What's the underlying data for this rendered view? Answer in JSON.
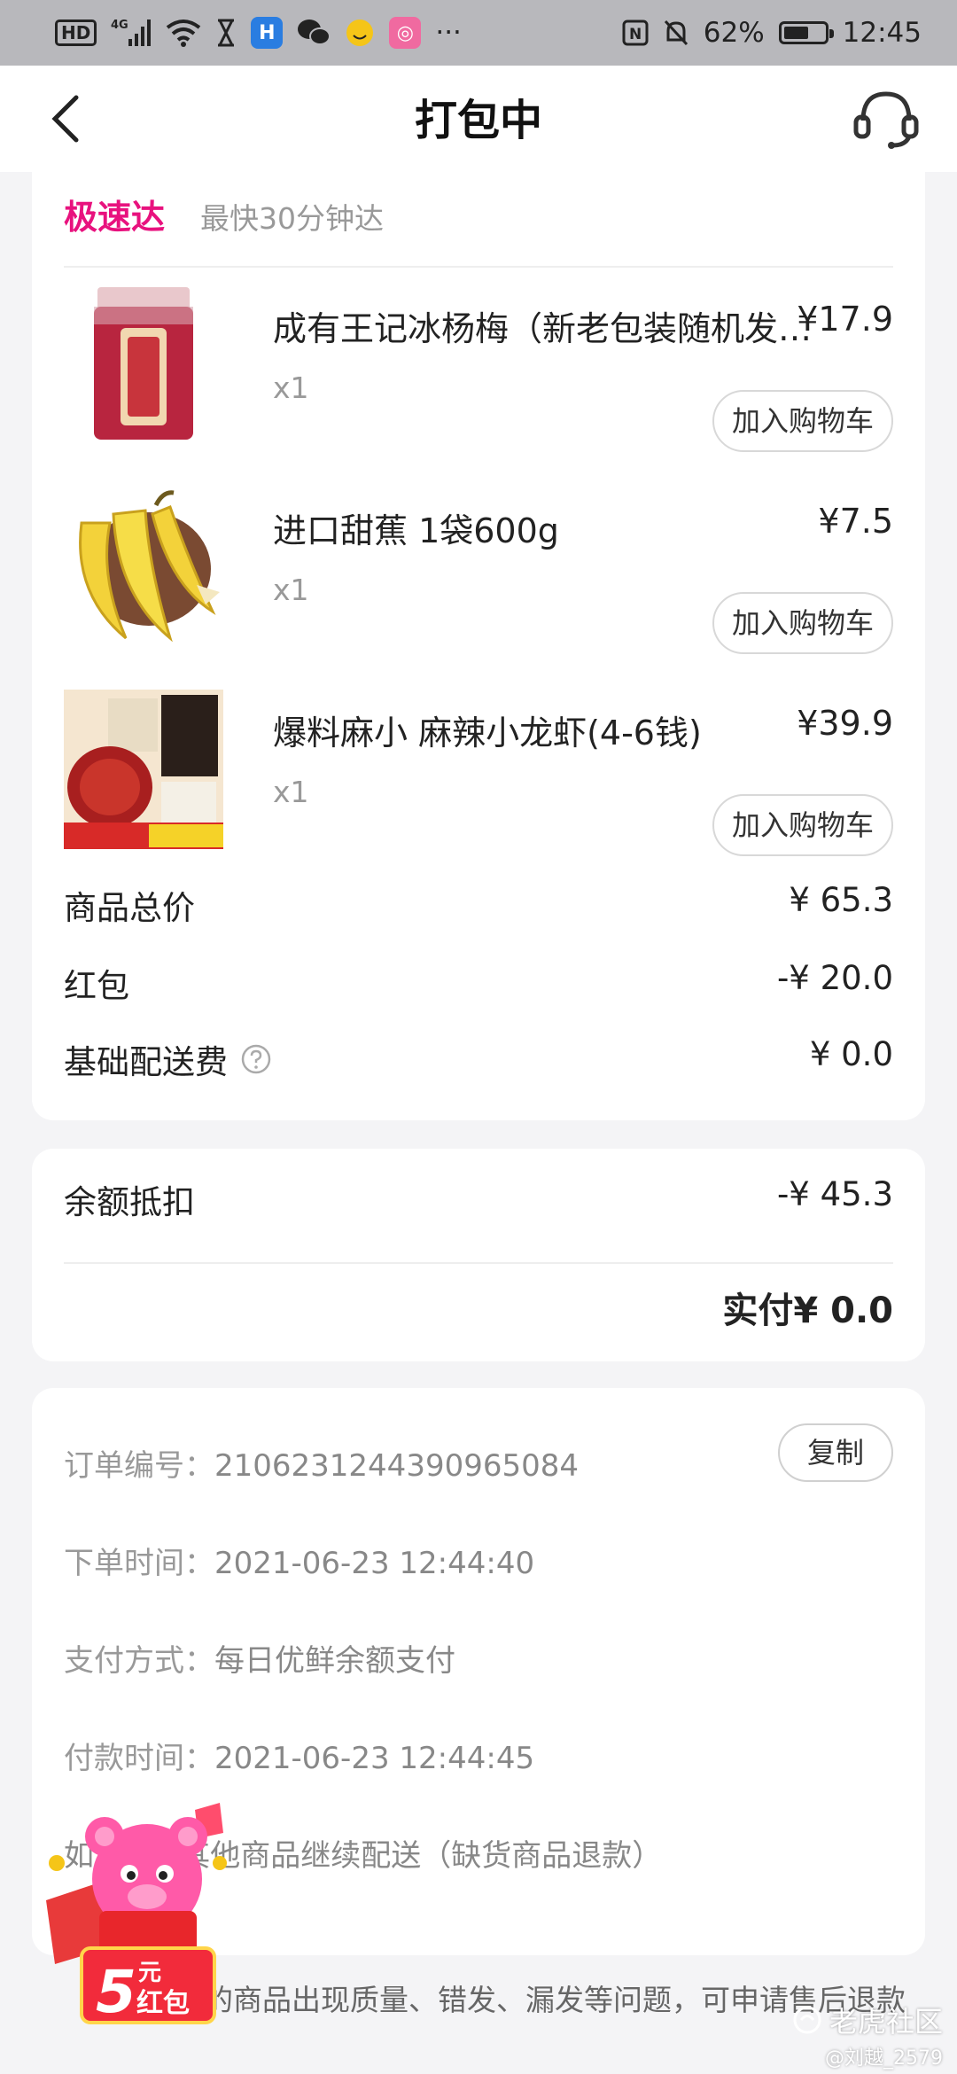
{
  "status_bar": {
    "network": "4G",
    "hd": "HD",
    "nfc": "N",
    "battery_percent": "62%",
    "battery_level": 0.62,
    "time": "12:45",
    "more": "···"
  },
  "header": {
    "title": "打包中"
  },
  "delivery": {
    "tag": "极速达",
    "desc": "最快30分钟达"
  },
  "products": [
    {
      "name": "成有王记冰杨梅（新老包装随机发货）",
      "price": "¥17.9",
      "qty": "x1",
      "cart_label": "加入购物车"
    },
    {
      "name": "进口甜蕉 1袋600g",
      "price": "¥7.5",
      "qty": "x1",
      "cart_label": "加入购物车"
    },
    {
      "name": "爆料麻小 麻辣小龙虾(4-6钱)",
      "price": "¥39.9",
      "qty": "x1",
      "cart_label": "加入购物车"
    }
  ],
  "summary": {
    "goods_total_label": "商品总价",
    "goods_total_value": "¥ 65.3",
    "red_packet_label": "红包",
    "red_packet_value": "-¥ 20.0",
    "delivery_fee_label": "基础配送费",
    "delivery_fee_value": "¥ 0.0"
  },
  "payment": {
    "balance_label": "余额抵扣",
    "balance_value": "-¥ 45.3",
    "actual_paid": "实付¥ 0.0"
  },
  "order_info": {
    "order_no_label": "订单编号：",
    "order_no_value": "2106231244390965084",
    "copy_label": "复制",
    "order_time_label": "下单时间：",
    "order_time_value": "2021-06-23 12:44:40",
    "pay_method_label": "支付方式：",
    "pay_method_value": "每日优鲜余额支付",
    "pay_time_label": "付款时间：",
    "pay_time_value": "2021-06-23 12:44:45",
    "stockout_text": "如         其他商品继续配送（缺货商品退款）"
  },
  "bottom_note": "的商品出现质量、错发、漏发等问题，可申请售后退款",
  "promo": {
    "amount": "5",
    "unit": "元",
    "label": "红包"
  },
  "watermark": {
    "text": "老虎社区",
    "sub": "@刘越_2579"
  },
  "colors": {
    "accent": "#e8127e",
    "background": "#f4f4f6",
    "status_bar": "#b8b8bc"
  }
}
